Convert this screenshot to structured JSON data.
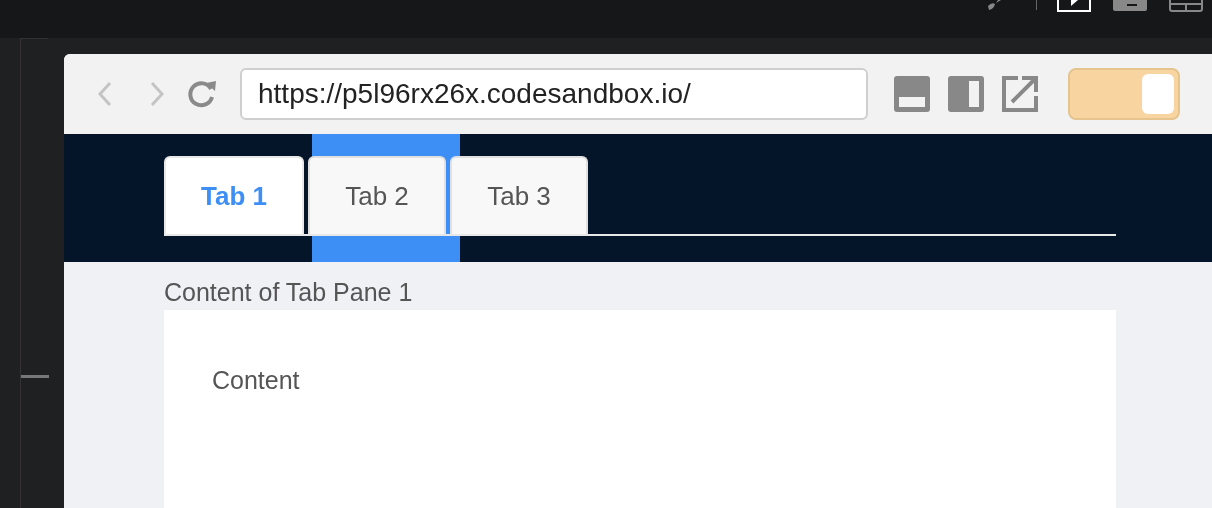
{
  "address_bar": {
    "value": "https://p5l96rx26x.codesandbox.io/"
  },
  "toggle": {
    "on": true
  },
  "tabs": [
    {
      "label": "Tab 1",
      "selected": true,
      "highlighted": false
    },
    {
      "label": "Tab 2",
      "selected": false,
      "highlighted": true
    },
    {
      "label": "Tab 3",
      "selected": false,
      "highlighted": false
    }
  ],
  "pane": {
    "title": "Content of Tab Pane 1",
    "body": "Content"
  }
}
